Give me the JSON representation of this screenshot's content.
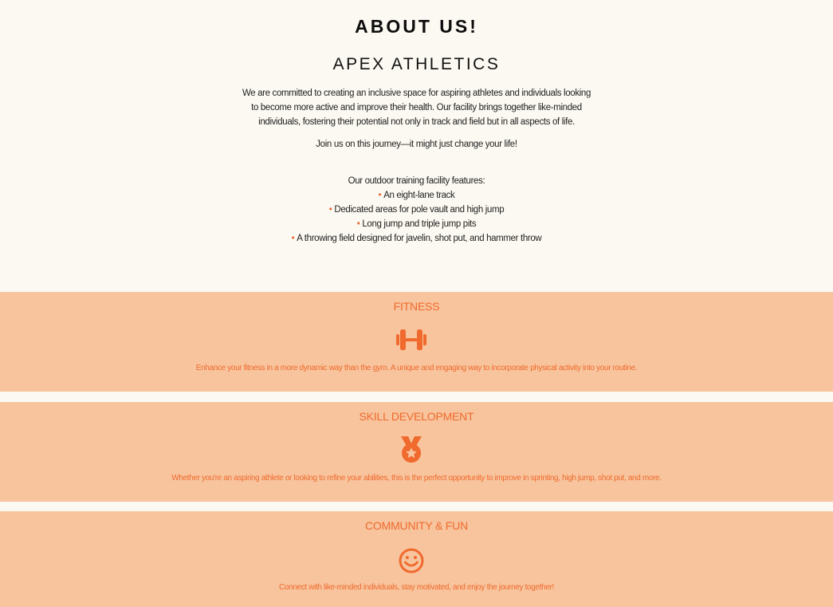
{
  "about": {
    "heading": "ABOUT US!",
    "subheading": "APEX ATHLETICS",
    "body": "We are committed to creating an inclusive space for aspiring athletes and individuals looking to become more active and improve their health. Our facility brings together like-minded individuals, fostering their potential not only in track and field but in all aspects of life.",
    "join": "Join us on this journey—it might just change your life!",
    "features_intro": "Our outdoor training facility features:",
    "features": [
      "An eight-lane track",
      "Dedicated areas for pole vault and high jump",
      "Long jump and triple jump pits",
      "A throwing field designed for javelin, shot put, and hammer throw"
    ],
    "bullet_symbol": "•"
  },
  "sections": [
    {
      "title": "FITNESS",
      "icon": "dumbbell-icon",
      "text": "Enhance your fitness in a more dynamic way than the gym. A unique and engaging way to incorporate physical activity into your routine."
    },
    {
      "title": "SKILL DEVELOPMENT",
      "icon": "medal-icon",
      "text": "Whether you're an aspiring athlete or looking to refine your abilities, this is the perfect opportunity to improve in sprinting, high jump, shot put, and more."
    },
    {
      "title": "COMMUNITY & FUN",
      "icon": "smiley-icon",
      "text": "Connect with like-minded individuals, stay motivated, and enjoy the journey together!"
    }
  ],
  "colors": {
    "page_background": "#fbf9f1",
    "band_background": "#f7c49d",
    "accent": "#f06a2e",
    "text": "#222222"
  }
}
